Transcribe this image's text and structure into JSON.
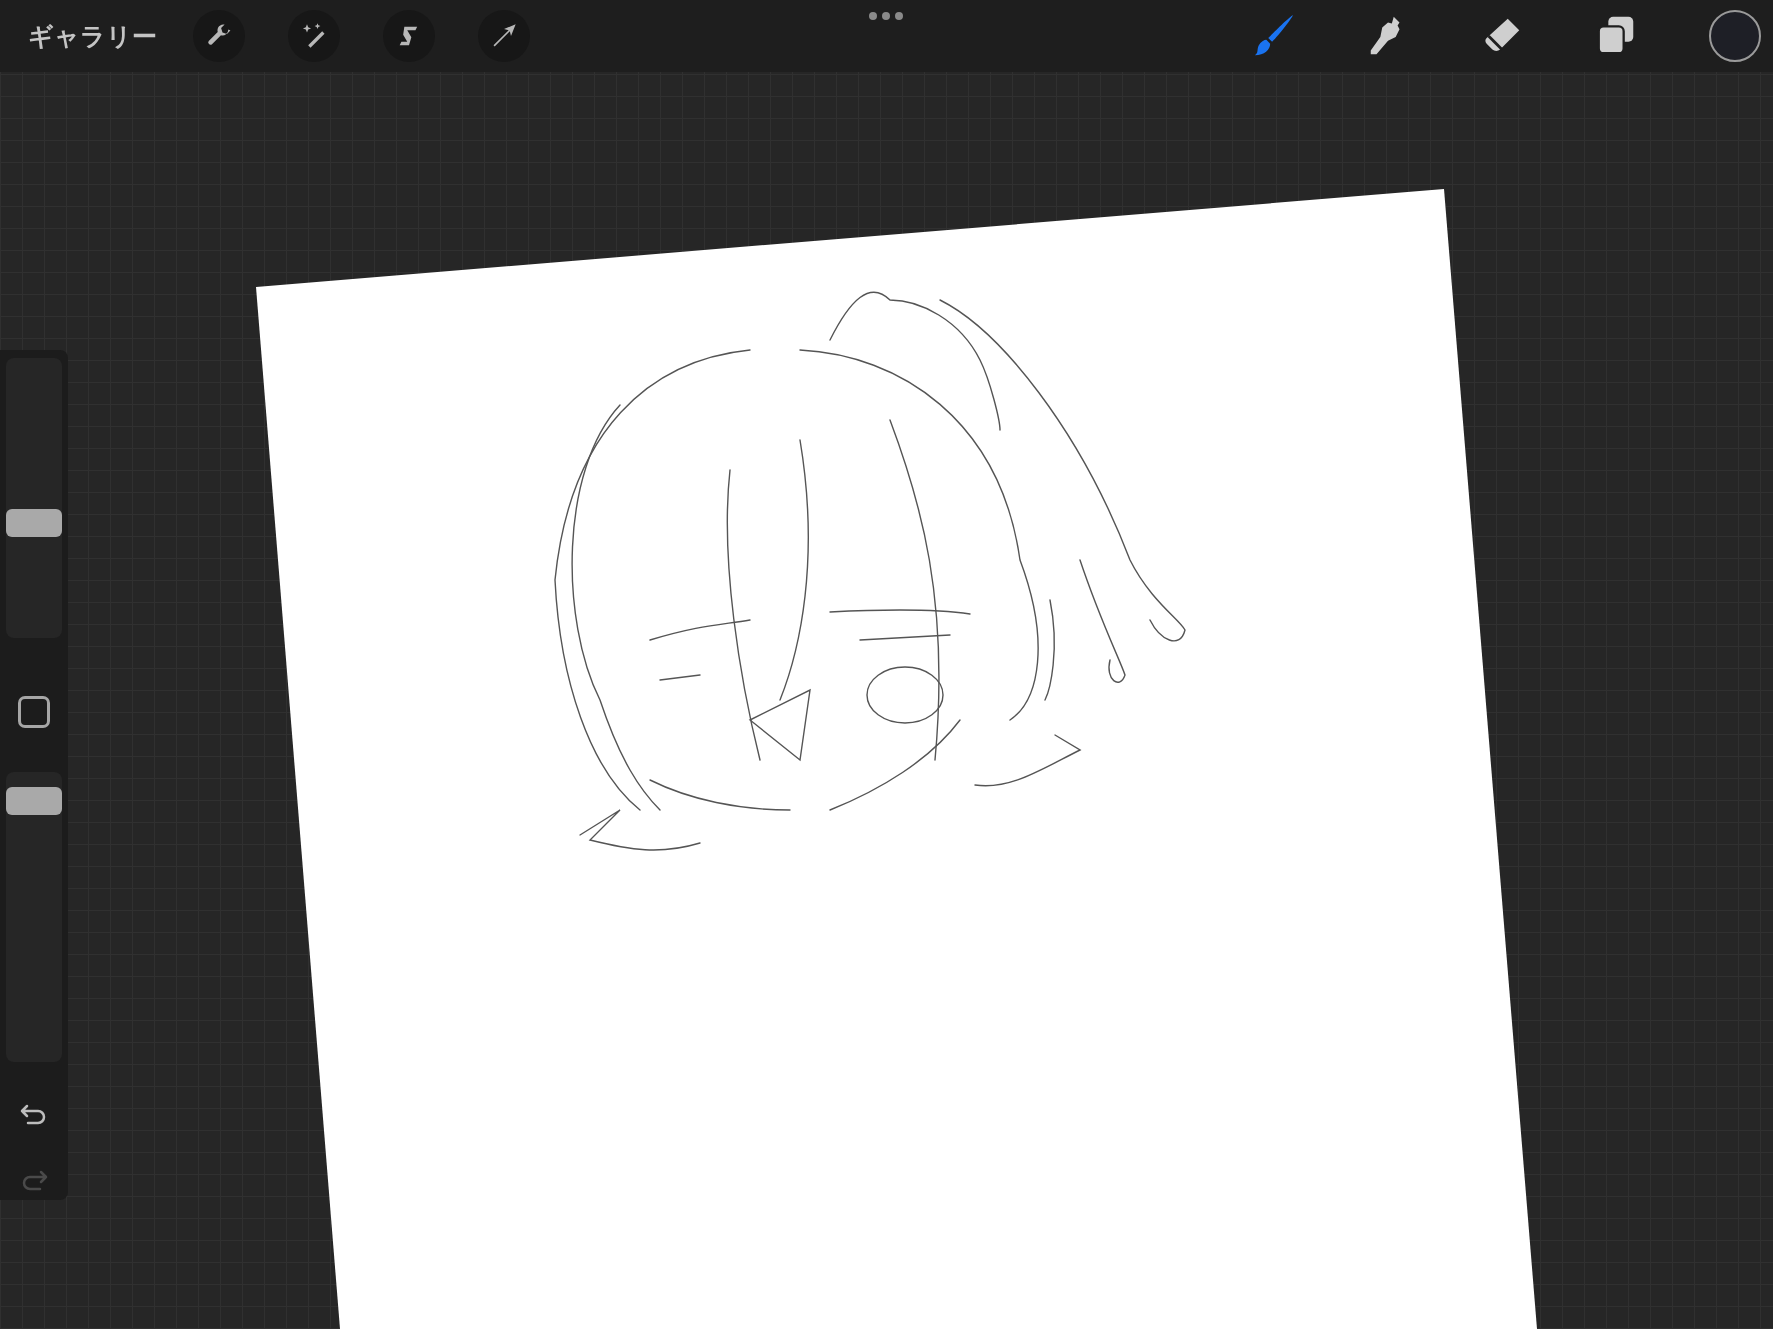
{
  "top_bar": {
    "gallery_label": "ギャラリー",
    "actions": [
      {
        "kind": "wrench"
      },
      {
        "kind": "wand"
      },
      {
        "kind": "selection"
      },
      {
        "kind": "transform"
      }
    ],
    "tools": [
      {
        "kind": "brush",
        "selected": true
      },
      {
        "kind": "smudge",
        "selected": false
      },
      {
        "kind": "eraser",
        "selected": false
      },
      {
        "kind": "layers",
        "selected": false
      }
    ],
    "color_swatch": {
      "color": "#1e1f26"
    }
  },
  "sidebar": {
    "brush_size": {
      "level": 0.41
    },
    "opacity": {
      "level": 0.9
    },
    "undo": {
      "disabled": false
    },
    "redo": {
      "disabled": true
    }
  }
}
